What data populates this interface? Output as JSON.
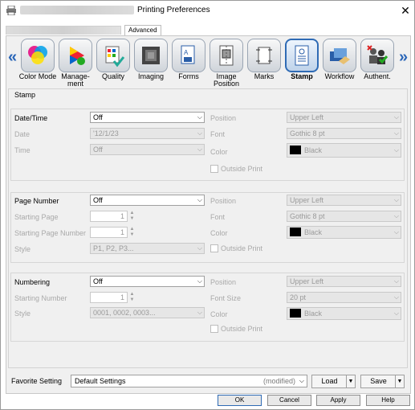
{
  "window": {
    "title": "Printing Preferences"
  },
  "tabs": {
    "advanced_label": "Advanced"
  },
  "categories": [
    {
      "label": "Color Mode",
      "icon": "color-mode-icon"
    },
    {
      "label": "Manage-\nment",
      "icon": "management-icon"
    },
    {
      "label": "Quality",
      "icon": "quality-icon"
    },
    {
      "label": "Imaging",
      "icon": "imaging-icon"
    },
    {
      "label": "Forms",
      "icon": "forms-icon"
    },
    {
      "label": "Image\nPosition",
      "icon": "image-position-icon"
    },
    {
      "label": "Marks",
      "icon": "marks-icon"
    },
    {
      "label": "Stamp",
      "icon": "stamp-icon",
      "active": true
    },
    {
      "label": "Workflow",
      "icon": "workflow-icon"
    },
    {
      "label": "Authent.",
      "icon": "authentication-icon"
    }
  ],
  "stamp": {
    "section_title": "Stamp",
    "datetime": {
      "label": "Date/Time",
      "value": "Off",
      "date_label": "Date",
      "date_value": "'12/1/23",
      "time_label": "Time",
      "time_value": "Off",
      "position_label": "Position",
      "position_value": "Upper Left",
      "font_label": "Font",
      "font_value": "Gothic 8 pt",
      "color_label": "Color",
      "color_value": "Black",
      "outside_print_label": "Outside Print"
    },
    "page_number": {
      "label": "Page Number",
      "value": "Off",
      "starting_page_label": "Starting Page",
      "starting_page_value": "1",
      "starting_page_number_label": "Starting Page Number",
      "starting_page_number_value": "1",
      "style_label": "Style",
      "style_value": "P1, P2, P3...",
      "position_label": "Position",
      "position_value": "Upper Left",
      "font_label": "Font",
      "font_value": "Gothic 8 pt",
      "color_label": "Color",
      "color_value": "Black",
      "outside_print_label": "Outside Print"
    },
    "numbering": {
      "label": "Numbering",
      "value": "Off",
      "starting_number_label": "Starting Number",
      "starting_number_value": "1",
      "style_label": "Style",
      "style_value": "0001, 0002, 0003...",
      "position_label": "Position",
      "position_value": "Upper Left",
      "font_size_label": "Font Size",
      "font_size_value": "20 pt",
      "color_label": "Color",
      "color_value": "Black",
      "outside_print_label": "Outside Print"
    }
  },
  "footer": {
    "favorite_label": "Favorite Setting",
    "favorite_value": "Default Settings",
    "favorite_modified": "(modified)",
    "load_label": "Load",
    "save_label": "Save"
  },
  "buttons": {
    "ok": "OK",
    "cancel": "Cancel",
    "apply": "Apply",
    "help": "Help"
  },
  "colors": {
    "accent": "#2f6bb5",
    "arrow": "#2a66b8"
  }
}
